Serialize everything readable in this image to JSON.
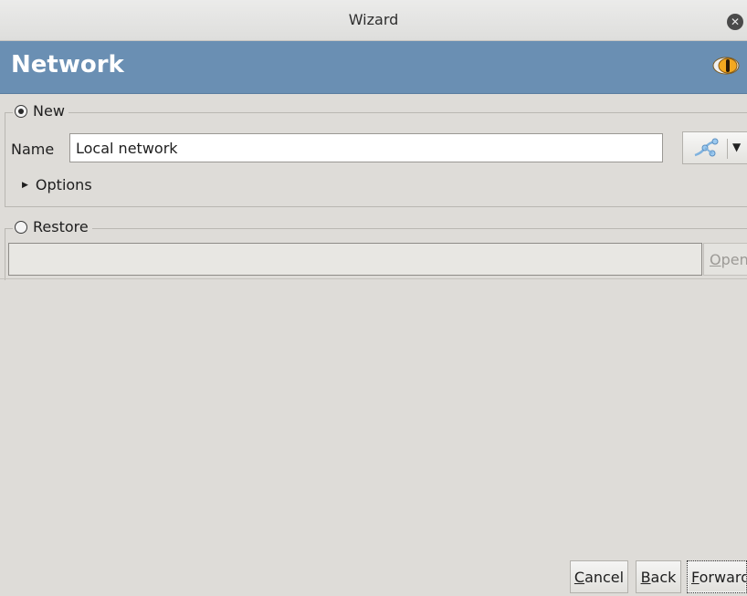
{
  "window": {
    "title": "Wizard",
    "close_icon": "close-icon"
  },
  "banner": {
    "heading": "Network",
    "logo_icon": "eye-logo-icon",
    "bg_color": "#6a8fb3"
  },
  "new_section": {
    "legend": "New",
    "selected": true,
    "name_label": "Name",
    "name_value": "Local network",
    "network_menu_icon": "network-icon",
    "options_label": "Options"
  },
  "restore_section": {
    "legend": "Restore",
    "selected": false,
    "path_value": "",
    "open_button": {
      "label_first": "O",
      "label_rest": "pen"
    }
  },
  "footer": {
    "cancel": {
      "accel": "C",
      "rest": "ancel"
    },
    "back": {
      "accel": "B",
      "rest": "ack"
    },
    "forward": {
      "accel": "F",
      "rest": "orward"
    }
  }
}
